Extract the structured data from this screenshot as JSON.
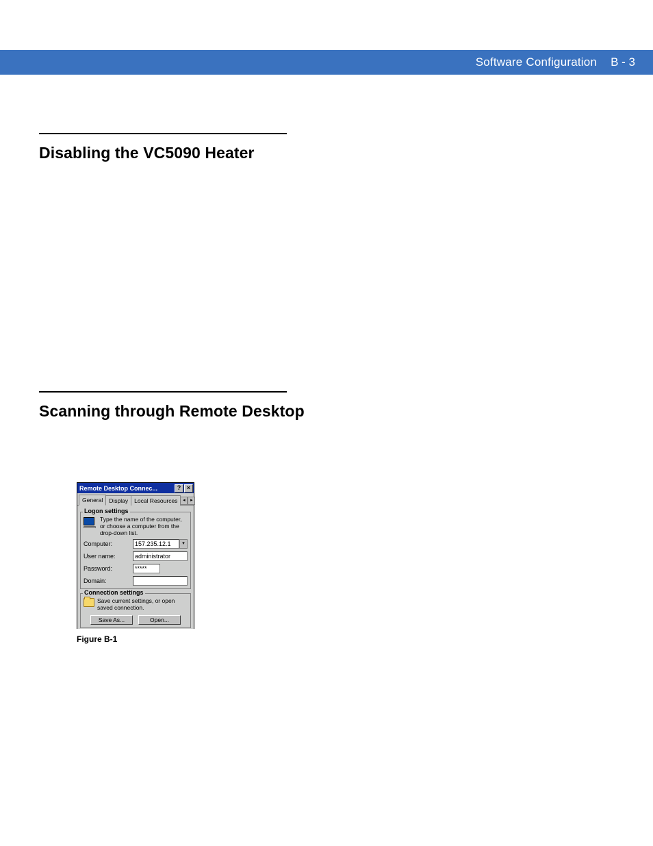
{
  "header": {
    "title": "Software Configuration",
    "page": "B - 3"
  },
  "section1": {
    "title": "Disabling the VC5090 Heater"
  },
  "section2": {
    "title": "Scanning through Remote Desktop"
  },
  "figure": {
    "caption": "Figure B-1"
  },
  "rdc": {
    "title": "Remote Desktop Connec...",
    "help": "?",
    "close": "×",
    "tabs": {
      "general": "General",
      "display": "Display",
      "local": "Local Resources",
      "scroll_left": "◂",
      "scroll_right": "▸"
    },
    "logon": {
      "legend": "Logon settings",
      "hint": "Type the name of the computer, or choose a computer from the drop-down list.",
      "computer_label": "Computer:",
      "computer_value": "157.235.12.1",
      "dropdown": "▾",
      "user_label": "User name:",
      "user_value": "administrator",
      "password_label": "Password:",
      "password_value": "*****",
      "domain_label": "Domain:",
      "domain_value": ""
    },
    "conn": {
      "legend": "Connection settings",
      "text": "Save current settings, or open saved connection.",
      "saveas": "Save As...",
      "open": "Open..."
    }
  }
}
